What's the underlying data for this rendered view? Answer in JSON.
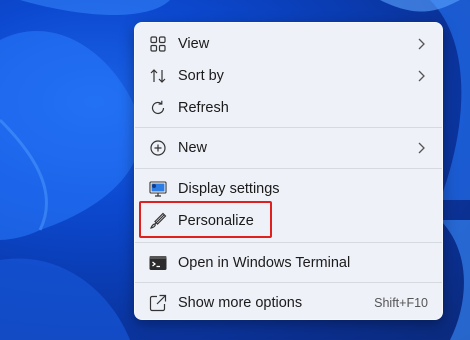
{
  "menu": {
    "items": [
      {
        "label": "View",
        "icon": "grid-icon",
        "submenu": true
      },
      {
        "label": "Sort by",
        "icon": "sort-icon",
        "submenu": true
      },
      {
        "label": "Refresh",
        "icon": "refresh-icon",
        "submenu": false
      },
      {
        "label": "New",
        "icon": "plus-circle-icon",
        "submenu": true
      },
      {
        "label": "Display settings",
        "icon": "display-icon",
        "submenu": false
      },
      {
        "label": "Personalize",
        "icon": "brush-icon",
        "submenu": false,
        "highlighted": true
      },
      {
        "label": "Open in Windows Terminal",
        "icon": "terminal-icon",
        "submenu": false
      },
      {
        "label": "Show more options",
        "icon": "share-icon",
        "submenu": false,
        "shortcut": "Shift+F10"
      }
    ]
  },
  "colors": {
    "highlight_border": "#e0201f",
    "wallpaper_blue": "#0c49d0",
    "menu_bg": "#eef1f8"
  }
}
